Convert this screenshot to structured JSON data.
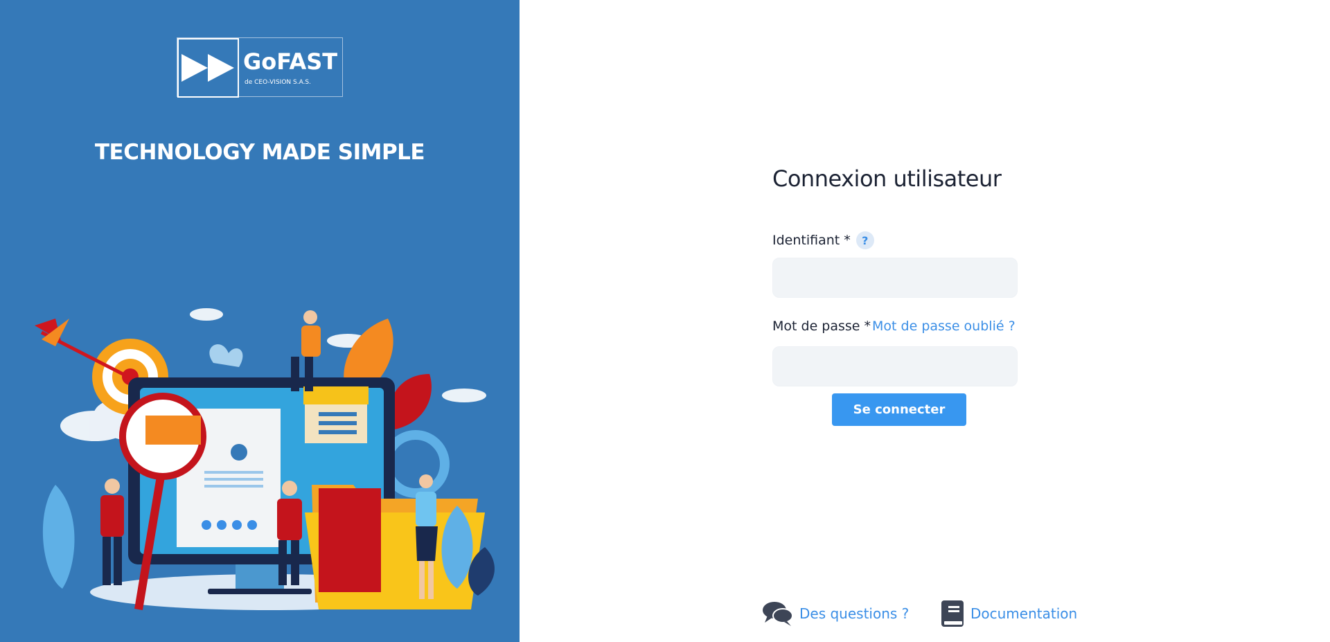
{
  "brand": {
    "name": "GoFAST",
    "subtitle": "de CEO-VISION S.A.S.",
    "tagline": "TECHNOLOGY MADE SIMPLE"
  },
  "login": {
    "title": "Connexion utilisateur",
    "username_label": "Identifiant *",
    "username_help": "?",
    "username_value": "",
    "password_label": "Mot de passe *",
    "forgot_password": "Mot de passe oublié ?",
    "password_value": "",
    "submit_label": "Se connecter"
  },
  "footer": {
    "questions_label": "Des questions ?",
    "questions_icon": "chat-bubbles-icon",
    "documentation_label": "Documentation",
    "documentation_icon": "book-icon"
  },
  "colors": {
    "panel_blue": "#3579b8",
    "accent_blue": "#3897f0",
    "link_blue": "#3a8ee6",
    "input_bg": "#f1f4f7",
    "text_dark": "#1b2233"
  }
}
